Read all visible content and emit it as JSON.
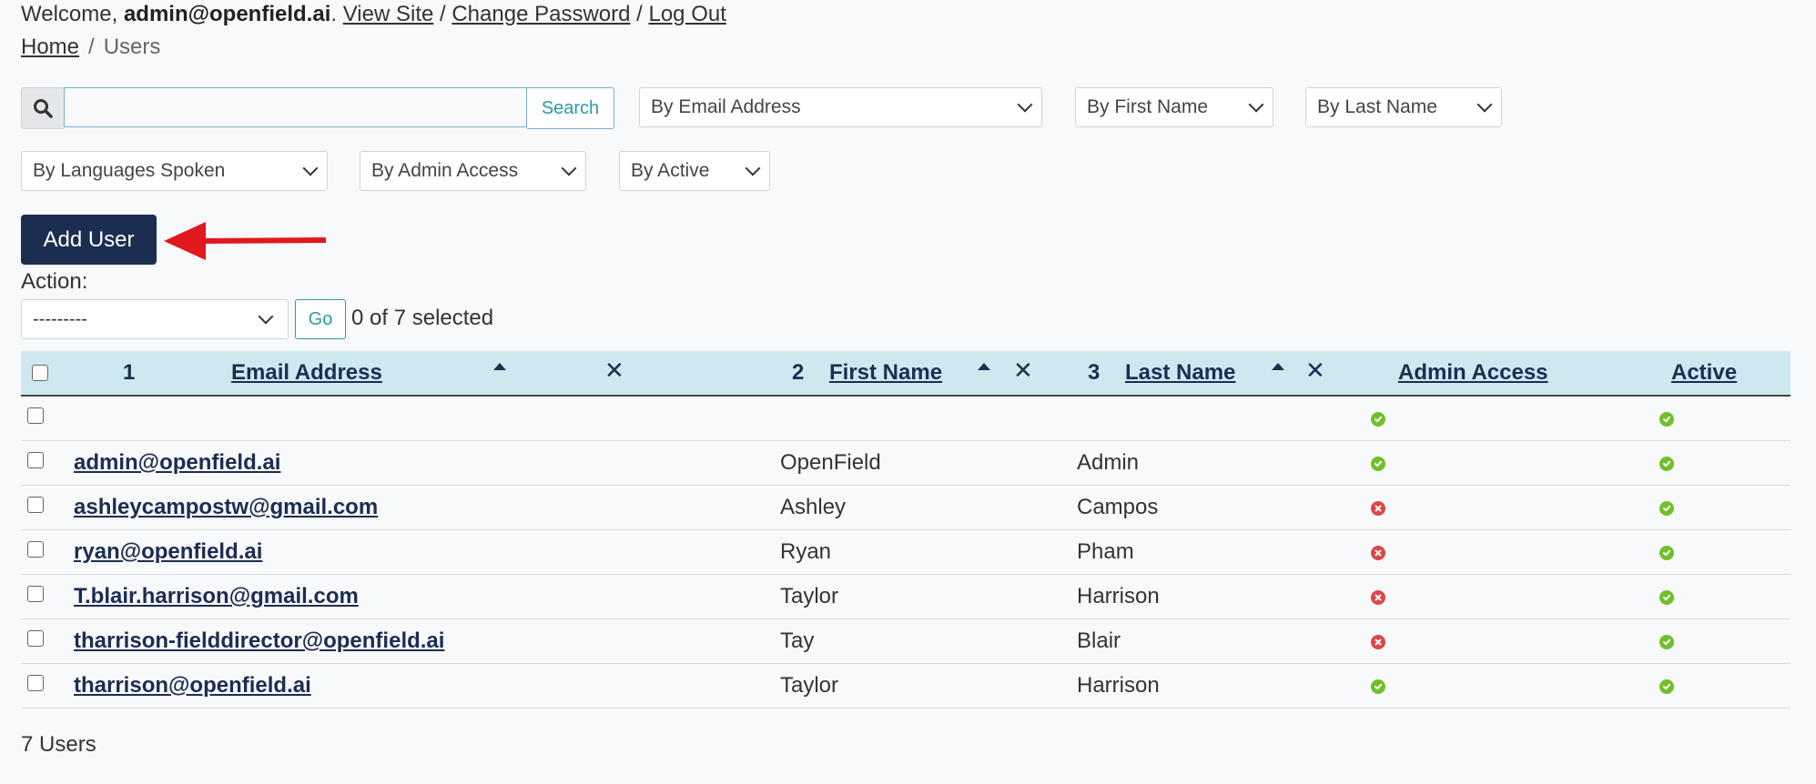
{
  "header": {
    "welcome": "Welcome,",
    "username": "admin@openfield.ai",
    "view_site": "View Site",
    "change_password": "Change Password",
    "log_out": "Log Out"
  },
  "breadcrumb": {
    "home": "Home",
    "current": "Users"
  },
  "search": {
    "value": "",
    "button": "Search"
  },
  "filters": {
    "email": "By Email Address",
    "first_name": "By First Name",
    "last_name": "By Last Name",
    "languages": "By Languages Spoken",
    "admin_access": "By Admin Access",
    "active": "By Active"
  },
  "add_user": "Add User",
  "actions": {
    "label": "Action:",
    "selected": "---------",
    "go": "Go",
    "counter": "0 of 7 selected"
  },
  "table": {
    "headers": {
      "email": "Email Address",
      "first_name": "First Name",
      "last_name": "Last Name",
      "admin_access": "Admin Access",
      "active": "Active"
    },
    "sort_priority": {
      "email": "1",
      "first_name": "2",
      "last_name": "3"
    },
    "rows": [
      {
        "email": "",
        "first_name": "",
        "last_name": "",
        "admin_access": true,
        "active": true
      },
      {
        "email": "admin@openfield.ai",
        "first_name": "OpenField",
        "last_name": "Admin",
        "admin_access": true,
        "active": true
      },
      {
        "email": "ashleycampostw@gmail.com",
        "first_name": "Ashley",
        "last_name": "Campos",
        "admin_access": false,
        "active": true
      },
      {
        "email": "ryan@openfield.ai",
        "first_name": "Ryan",
        "last_name": "Pham",
        "admin_access": false,
        "active": true
      },
      {
        "email": "T.blair.harrison@gmail.com",
        "first_name": "Taylor",
        "last_name": "Harrison",
        "admin_access": false,
        "active": true
      },
      {
        "email": "tharrison-fielddirector@openfield.ai",
        "first_name": "Tay",
        "last_name": "Blair",
        "admin_access": false,
        "active": true
      },
      {
        "email": "tharrison@openfield.ai",
        "first_name": "Taylor",
        "last_name": "Harrison",
        "admin_access": true,
        "active": true
      }
    ]
  },
  "footer": {
    "count": "7 Users"
  },
  "colors": {
    "primary": "#1c2d52",
    "header_bg": "#cde9ef",
    "accent": "#2a9ba5",
    "yes": "#70bf2b",
    "no": "#dd4646",
    "arrow": "#e0191e"
  },
  "icons": {
    "search": "search-icon",
    "yes": "check-circle-icon",
    "no": "x-circle-icon"
  }
}
